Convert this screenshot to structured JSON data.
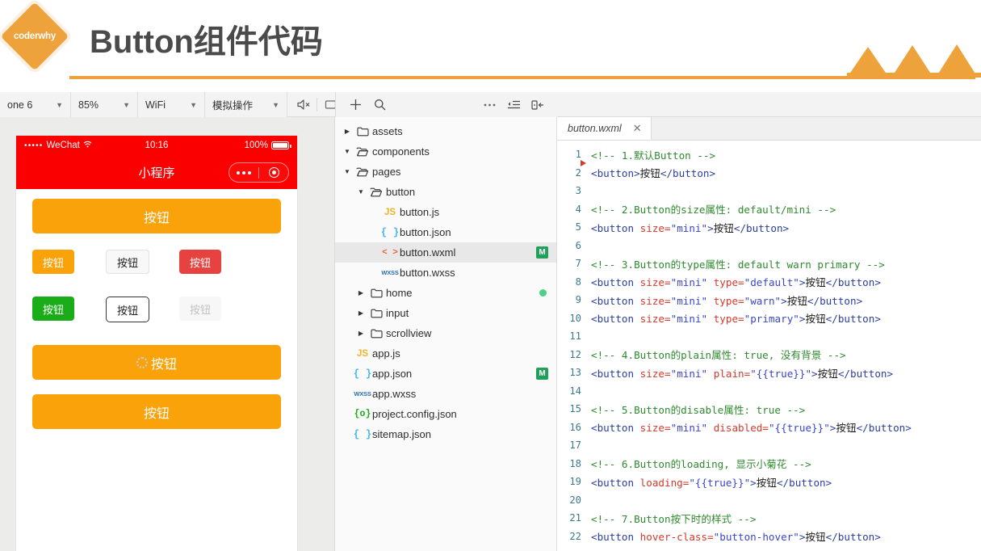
{
  "slide": {
    "logo_text": "coderwhy",
    "title": "Button组件代码",
    "accent_color": "#eda23b"
  },
  "ide": {
    "simulator_toolbar": {
      "device": "one 6",
      "zoom": "85%",
      "network": "WiFi",
      "action": "模拟操作",
      "icons": [
        "mute-icon",
        "screen-icon",
        "panel-right-icon"
      ]
    },
    "files_toolbar": {
      "icons": [
        "add-icon",
        "search-icon",
        "more-icon",
        "collapse-icon",
        "panel-toggle-icon"
      ]
    },
    "simulator": {
      "status_bar": {
        "signal_dots": "•••••",
        "carrier": "WeChat",
        "wifi": "≈",
        "time": "10:16",
        "battery_percent": "100%"
      },
      "nav_title": "小程序",
      "buttons": {
        "default_full": "按钮",
        "mini_default": "按钮",
        "type_default": "按钮",
        "type_warn": "按钮",
        "type_primary": "按钮",
        "plain_outline": "按钮",
        "disabled": "按钮",
        "loading": "按钮",
        "hover": "按钮"
      },
      "colors": {
        "orange": "#f9a209",
        "warn_red": "#e64340",
        "primary_green": "#1aad19",
        "status_red": "#fb0000",
        "disabled_text": "#c2c2c2"
      }
    },
    "file_tree": [
      {
        "indent": 0,
        "arrow": "right",
        "icon": "folder-closed-icon",
        "name": "assets",
        "badge": "",
        "dot": false
      },
      {
        "indent": 0,
        "arrow": "down",
        "icon": "folder-open-icon",
        "name": "components",
        "badge": "",
        "dot": false
      },
      {
        "indent": 0,
        "arrow": "down",
        "icon": "folder-open-icon",
        "name": "pages",
        "badge": "",
        "dot": false
      },
      {
        "indent": 1,
        "arrow": "down",
        "icon": "folder-open-icon",
        "name": "button",
        "badge": "",
        "dot": false
      },
      {
        "indent": 2,
        "arrow": "none",
        "icon": "js-icon",
        "name": "button.js",
        "badge": "",
        "dot": false
      },
      {
        "indent": 2,
        "arrow": "none",
        "icon": "json-icon",
        "name": "button.json",
        "badge": "",
        "dot": false
      },
      {
        "indent": 2,
        "arrow": "none",
        "icon": "wxml-icon",
        "name": "button.wxml",
        "badge": "M",
        "dot": false,
        "selected": true
      },
      {
        "indent": 2,
        "arrow": "none",
        "icon": "wxss-icon",
        "name": "button.wxss",
        "badge": "",
        "dot": false
      },
      {
        "indent": 1,
        "arrow": "right",
        "icon": "folder-closed-icon",
        "name": "home",
        "badge": "",
        "dot": true
      },
      {
        "indent": 1,
        "arrow": "right",
        "icon": "folder-closed-icon",
        "name": "input",
        "badge": "",
        "dot": false
      },
      {
        "indent": 1,
        "arrow": "right",
        "icon": "folder-closed-icon",
        "name": "scrollview",
        "badge": "",
        "dot": false
      },
      {
        "indent": 0,
        "arrow": "none",
        "icon": "js-icon",
        "name": "app.js",
        "badge": "",
        "dot": false
      },
      {
        "indent": 0,
        "arrow": "none",
        "icon": "json-icon",
        "name": "app.json",
        "badge": "M",
        "dot": false
      },
      {
        "indent": 0,
        "arrow": "none",
        "icon": "wxss-icon",
        "name": "app.wxss",
        "badge": "",
        "dot": false
      },
      {
        "indent": 0,
        "arrow": "none",
        "icon": "config-icon",
        "name": "project.config.json",
        "badge": "",
        "dot": false
      },
      {
        "indent": 0,
        "arrow": "none",
        "icon": "json-icon",
        "name": "sitemap.json",
        "badge": "",
        "dot": false
      }
    ],
    "editor": {
      "tab_label": "button.wxml",
      "close_label": "✕",
      "lines": [
        {
          "n": "1",
          "segs": [
            {
              "t": "<!-- 1.默认Button -->",
              "c": "c-cmt"
            }
          ]
        },
        {
          "n": "2",
          "segs": [
            {
              "t": "<button>",
              "c": "c-tag"
            },
            {
              "t": "按钮",
              "c": "c-txt"
            },
            {
              "t": "</button>",
              "c": "c-tag"
            }
          ]
        },
        {
          "n": "3",
          "segs": []
        },
        {
          "n": "4",
          "segs": [
            {
              "t": "<!-- 2.Button的size属性: default/mini -->",
              "c": "c-cmt"
            }
          ]
        },
        {
          "n": "5",
          "segs": [
            {
              "t": "<button ",
              "c": "c-tag"
            },
            {
              "t": "size",
              "c": "c-attr"
            },
            {
              "t": "=",
              "c": "c-attr"
            },
            {
              "t": "\"mini\"",
              "c": "c-str"
            },
            {
              "t": ">",
              "c": "c-tag"
            },
            {
              "t": "按钮",
              "c": "c-txt"
            },
            {
              "t": "</button>",
              "c": "c-tag"
            }
          ]
        },
        {
          "n": "6",
          "segs": []
        },
        {
          "n": "7",
          "segs": [
            {
              "t": "<!-- 3.Button的type属性: default warn primary -->",
              "c": "c-cmt"
            }
          ]
        },
        {
          "n": "8",
          "segs": [
            {
              "t": "<button ",
              "c": "c-tag"
            },
            {
              "t": "size",
              "c": "c-attr"
            },
            {
              "t": "=",
              "c": "c-attr"
            },
            {
              "t": "\"mini\"",
              "c": "c-str"
            },
            {
              "t": " ",
              "c": "c-tag"
            },
            {
              "t": "type",
              "c": "c-attr"
            },
            {
              "t": "=",
              "c": "c-attr"
            },
            {
              "t": "\"default\"",
              "c": "c-str"
            },
            {
              "t": ">",
              "c": "c-tag"
            },
            {
              "t": "按钮",
              "c": "c-txt"
            },
            {
              "t": "</button>",
              "c": "c-tag"
            }
          ]
        },
        {
          "n": "9",
          "segs": [
            {
              "t": "<button ",
              "c": "c-tag"
            },
            {
              "t": "size",
              "c": "c-attr"
            },
            {
              "t": "=",
              "c": "c-attr"
            },
            {
              "t": "\"mini\"",
              "c": "c-str"
            },
            {
              "t": " ",
              "c": "c-tag"
            },
            {
              "t": "type",
              "c": "c-attr"
            },
            {
              "t": "=",
              "c": "c-attr"
            },
            {
              "t": "\"warn\"",
              "c": "c-str"
            },
            {
              "t": ">",
              "c": "c-tag"
            },
            {
              "t": "按钮",
              "c": "c-txt"
            },
            {
              "t": "</button>",
              "c": "c-tag"
            }
          ]
        },
        {
          "n": "10",
          "segs": [
            {
              "t": "<button ",
              "c": "c-tag"
            },
            {
              "t": "size",
              "c": "c-attr"
            },
            {
              "t": "=",
              "c": "c-attr"
            },
            {
              "t": "\"mini\"",
              "c": "c-str"
            },
            {
              "t": " ",
              "c": "c-tag"
            },
            {
              "t": "type",
              "c": "c-attr"
            },
            {
              "t": "=",
              "c": "c-attr"
            },
            {
              "t": "\"primary\"",
              "c": "c-str"
            },
            {
              "t": ">",
              "c": "c-tag"
            },
            {
              "t": "按钮",
              "c": "c-txt"
            },
            {
              "t": "</button>",
              "c": "c-tag"
            }
          ]
        },
        {
          "n": "11",
          "segs": []
        },
        {
          "n": "12",
          "segs": [
            {
              "t": "<!-- 4.Button的plain属性: true, 没有背景 -->",
              "c": "c-cmt"
            }
          ]
        },
        {
          "n": "13",
          "segs": [
            {
              "t": "<button ",
              "c": "c-tag"
            },
            {
              "t": "size",
              "c": "c-attr"
            },
            {
              "t": "=",
              "c": "c-attr"
            },
            {
              "t": "\"mini\"",
              "c": "c-str"
            },
            {
              "t": " ",
              "c": "c-tag"
            },
            {
              "t": "plain",
              "c": "c-attr"
            },
            {
              "t": "=",
              "c": "c-attr"
            },
            {
              "t": "\"{{true}}\"",
              "c": "c-str"
            },
            {
              "t": ">",
              "c": "c-tag"
            },
            {
              "t": "按钮",
              "c": "c-txt"
            },
            {
              "t": "</button>",
              "c": "c-tag"
            }
          ]
        },
        {
          "n": "14",
          "segs": []
        },
        {
          "n": "15",
          "segs": [
            {
              "t": "<!-- 5.Button的disable属性: true -->",
              "c": "c-cmt"
            }
          ]
        },
        {
          "n": "16",
          "segs": [
            {
              "t": "<button ",
              "c": "c-tag"
            },
            {
              "t": "size",
              "c": "c-attr"
            },
            {
              "t": "=",
              "c": "c-attr"
            },
            {
              "t": "\"mini\"",
              "c": "c-str"
            },
            {
              "t": " ",
              "c": "c-tag"
            },
            {
              "t": "disabled",
              "c": "c-attr"
            },
            {
              "t": "=",
              "c": "c-attr"
            },
            {
              "t": "\"{{true}}\"",
              "c": "c-str"
            },
            {
              "t": ">",
              "c": "c-tag"
            },
            {
              "t": "按钮",
              "c": "c-txt"
            },
            {
              "t": "</button>",
              "c": "c-tag"
            }
          ]
        },
        {
          "n": "17",
          "segs": []
        },
        {
          "n": "18",
          "segs": [
            {
              "t": "<!-- 6.Button的loading, 显示小菊花 -->",
              "c": "c-cmt"
            }
          ]
        },
        {
          "n": "19",
          "segs": [
            {
              "t": "<button ",
              "c": "c-tag"
            },
            {
              "t": "loading",
              "c": "c-attr"
            },
            {
              "t": "=",
              "c": "c-attr"
            },
            {
              "t": "\"{{true}}\"",
              "c": "c-str"
            },
            {
              "t": ">",
              "c": "c-tag"
            },
            {
              "t": "按钮",
              "c": "c-txt"
            },
            {
              "t": "</button>",
              "c": "c-tag"
            }
          ]
        },
        {
          "n": "20",
          "segs": []
        },
        {
          "n": "21",
          "segs": [
            {
              "t": "<!-- 7.Button按下时的样式 -->",
              "c": "c-cmt"
            }
          ]
        },
        {
          "n": "22",
          "segs": [
            {
              "t": "<button ",
              "c": "c-tag"
            },
            {
              "t": "hover-class",
              "c": "c-attr"
            },
            {
              "t": "=",
              "c": "c-attr"
            },
            {
              "t": "\"button-hover\"",
              "c": "c-str"
            },
            {
              "t": ">",
              "c": "c-tag"
            },
            {
              "t": "按钮",
              "c": "c-txt"
            },
            {
              "t": "</button>",
              "c": "c-tag"
            }
          ]
        }
      ]
    }
  }
}
